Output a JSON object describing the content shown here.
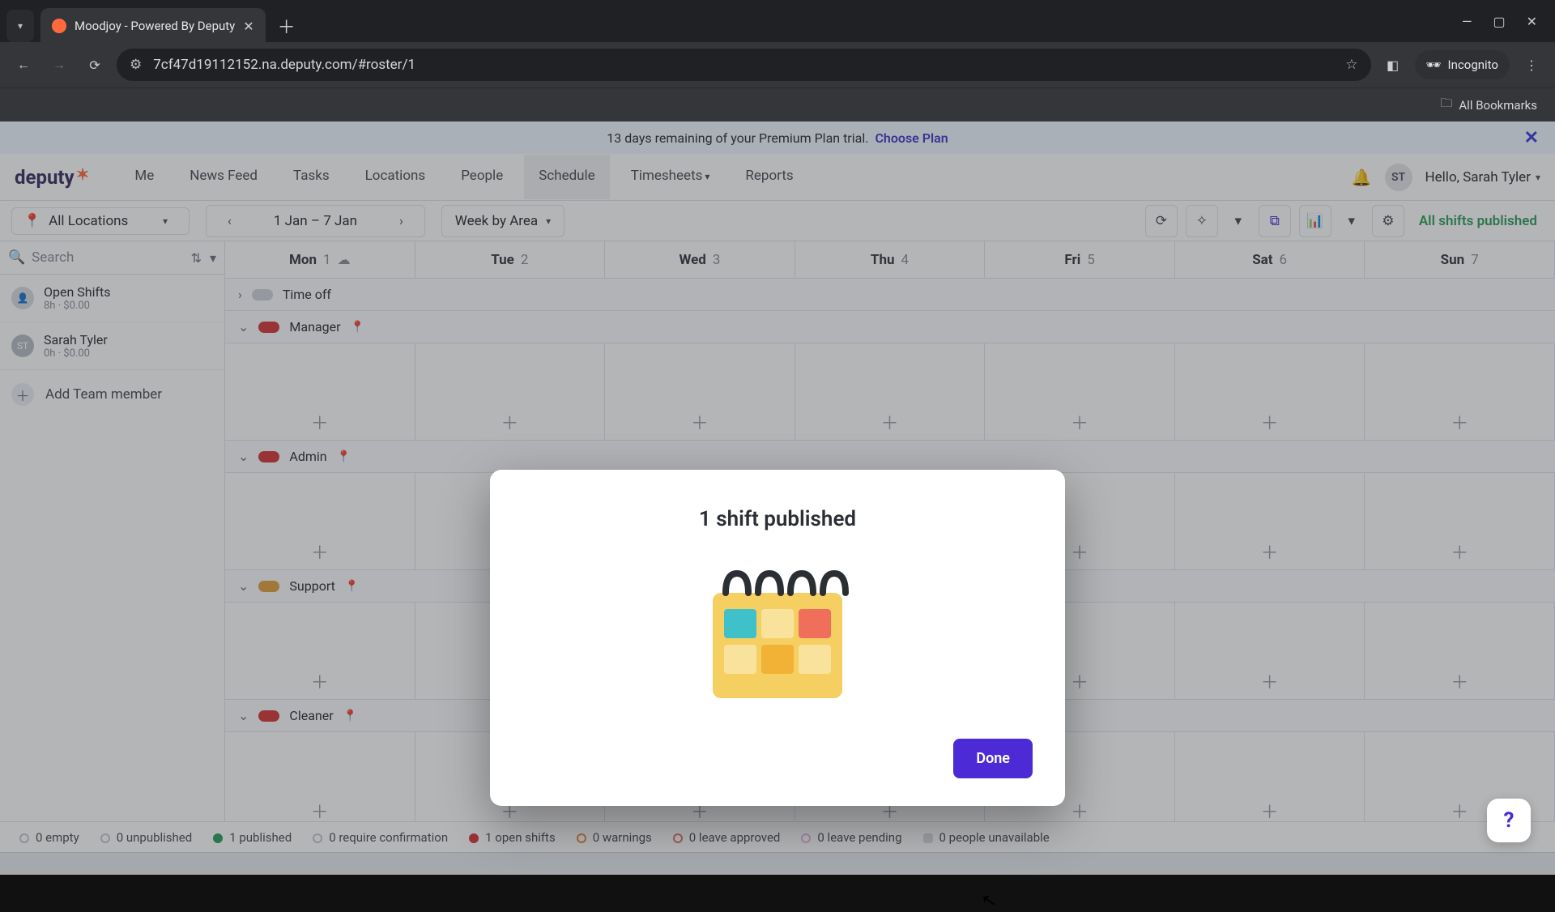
{
  "browser": {
    "tab_title": "Moodjoy - Powered By Deputy",
    "url": "7cf47d19112152.na.deputy.com/#roster/1",
    "incognito_label": "Incognito",
    "bookmarks_label": "All Bookmarks"
  },
  "trial": {
    "text": "13 days remaining of your Premium Plan trial.",
    "cta": "Choose Plan"
  },
  "nav": {
    "logo": "deputy",
    "items": [
      "Me",
      "News Feed",
      "Tasks",
      "Locations",
      "People",
      "Schedule",
      "Timesheets",
      "Reports"
    ],
    "active_index": 5,
    "greeting": "Hello, Sarah Tyler",
    "avatar_initials": "ST"
  },
  "subbar": {
    "location": "All Locations",
    "date_range": "1 Jan – 7 Jan",
    "view": "Week by Area",
    "publish_status": "All shifts published"
  },
  "sidebar": {
    "search_placeholder": "Search",
    "rows": [
      {
        "type": "open",
        "title": "Open Shifts",
        "sub": "8h · $0.00",
        "icon": "👤"
      },
      {
        "type": "user",
        "title": "Sarah Tyler",
        "sub": "0h · $0.00",
        "initials": "ST"
      }
    ],
    "add_member": "Add Team member"
  },
  "days": [
    {
      "label": "Mon",
      "num": "1",
      "weather": true
    },
    {
      "label": "Tue",
      "num": "2"
    },
    {
      "label": "Wed",
      "num": "3"
    },
    {
      "label": "Thu",
      "num": "4"
    },
    {
      "label": "Fri",
      "num": "5"
    },
    {
      "label": "Sat",
      "num": "6"
    },
    {
      "label": "Sun",
      "num": "7"
    }
  ],
  "groups": [
    {
      "name": "Time off",
      "color": "grey",
      "collapsed": true
    },
    {
      "name": "Manager",
      "color": "red",
      "collapsed": false
    },
    {
      "name": "Admin",
      "color": "red",
      "collapsed": false
    },
    {
      "name": "Support",
      "color": "amber",
      "collapsed": false
    },
    {
      "name": "Cleaner",
      "color": "red",
      "collapsed": false
    }
  ],
  "footer": {
    "items": [
      "0 empty",
      "0 unpublished",
      "1 published",
      "0 require confirmation",
      "1 open shifts",
      "0 warnings",
      "0 leave approved",
      "0 leave pending",
      "0 people unavailable"
    ]
  },
  "modal": {
    "title": "1 shift published",
    "done": "Done"
  }
}
